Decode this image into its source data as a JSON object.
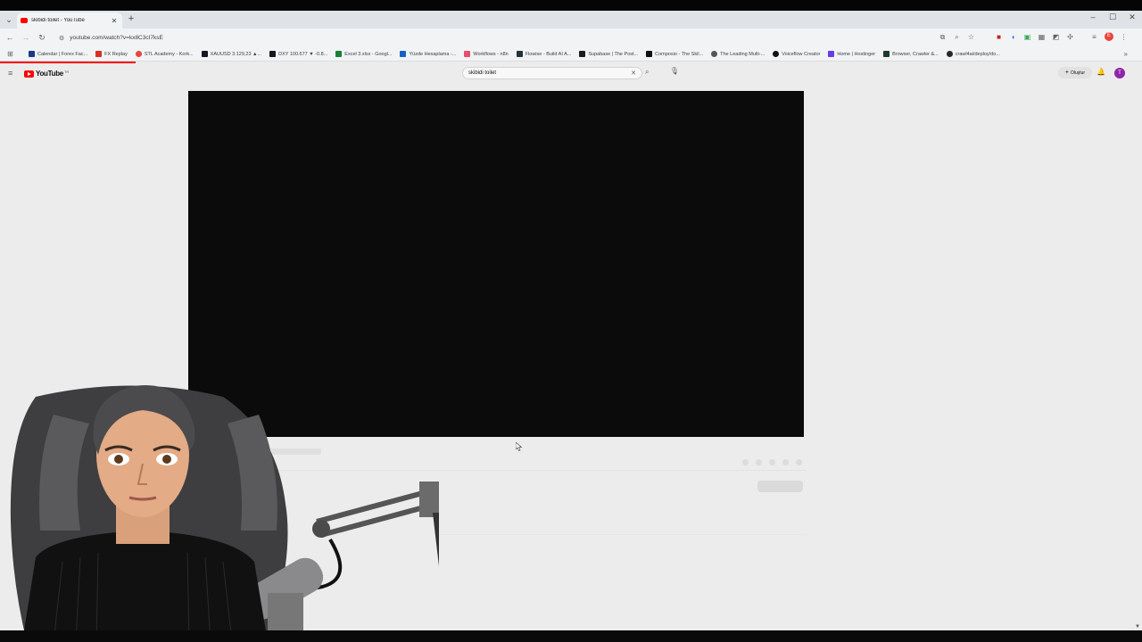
{
  "browser": {
    "tab": {
      "title": "skibidi toilet - YouTube"
    },
    "url": "youtube.com/watch?v=kx8C3cI7ksE",
    "bookmarks": [
      {
        "label": "Calendar | Forex Fac...",
        "color": "#1a3a8a"
      },
      {
        "label": "FX Replay",
        "color": "#d93025"
      },
      {
        "label": "STL Academy - Kork...",
        "color": "#e8453c"
      },
      {
        "label": "XAUUSD 3.129,23 ▲...",
        "color": "#131722"
      },
      {
        "label": "DXY 100.677 ▼ -0.8...",
        "color": "#131722"
      },
      {
        "label": "Excel 3.xlsx - Googl...",
        "color": "#188038"
      },
      {
        "label": "Yüzde Hesaplama -...",
        "color": "#1565c0"
      },
      {
        "label": "Workflows - n8n",
        "color": "#ea4b71"
      },
      {
        "label": "Flowise - Build AI A...",
        "color": "#263238"
      },
      {
        "label": "Supabase | The Post...",
        "color": "#1c1c1c"
      },
      {
        "label": "Composio - The Skil...",
        "color": "#111111"
      },
      {
        "label": "The Leading Multi-...",
        "color": "#555555"
      },
      {
        "label": "Voiceflow Creator",
        "color": "#111111"
      },
      {
        "label": "Home | Hostinger",
        "color": "#673de6"
      },
      {
        "label": "Browser, Crawler &...",
        "color": "#1b3a2b"
      },
      {
        "label": "crawl4ai/deploy/do...",
        "color": "#24292f"
      }
    ]
  },
  "youtube": {
    "logo_text": "YouTube",
    "logo_country": "TR",
    "search_query": "skibidi toilet",
    "create_label": "Oluştur",
    "avatar_letter": "T",
    "brand_color": "#ff0000"
  },
  "profile_letter": "E"
}
